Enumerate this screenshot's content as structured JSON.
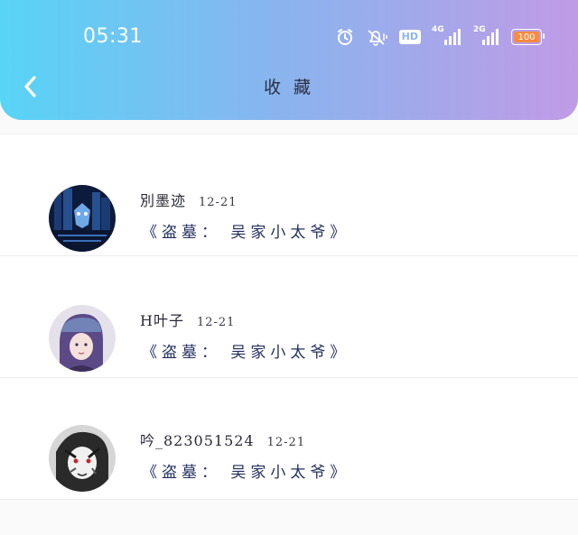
{
  "status_bar": {
    "time": "05:31",
    "network_4g": "4G",
    "network_2g": "2G",
    "hd_label": "HD",
    "battery_level": "100",
    "battery_color": "#ff8a3d"
  },
  "header": {
    "back_icon": "chevron-left-icon",
    "title": "收 藏"
  },
  "favorites": [
    {
      "user": "別墨迹",
      "date": "12-21",
      "title": "《盗墓： 吴家小太爷》"
    },
    {
      "user": "H叶子",
      "date": "12-21",
      "title": "《盗墓： 吴家小太爷》"
    },
    {
      "user": "吟_823051524",
      "date": "12-21",
      "title": "《盗墓： 吴家小太爷》"
    }
  ]
}
